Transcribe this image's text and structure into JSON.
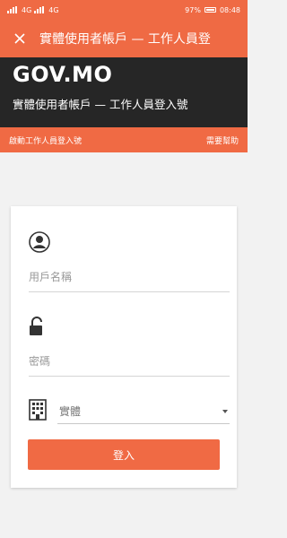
{
  "status_bar": {
    "carrier_left": "4G",
    "carrier_right": "4G",
    "battery": "97%",
    "time": "08:48"
  },
  "app_bar": {
    "title": "實體使用者帳戶 — 工作人員登"
  },
  "header": {
    "logo": "GOV.MO",
    "subtitle": "實體使用者帳戶 — 工作人員登入號"
  },
  "link_bar": {
    "left_link": "啟動工作人員登入號",
    "right_link": "需要幫助"
  },
  "form": {
    "username_placeholder": "用戶名稱",
    "password_placeholder": "密碼",
    "entity_select_value": "實體",
    "login_button": "登入"
  },
  "colors": {
    "accent": "#ef6a44",
    "header_bg": "#262626"
  }
}
